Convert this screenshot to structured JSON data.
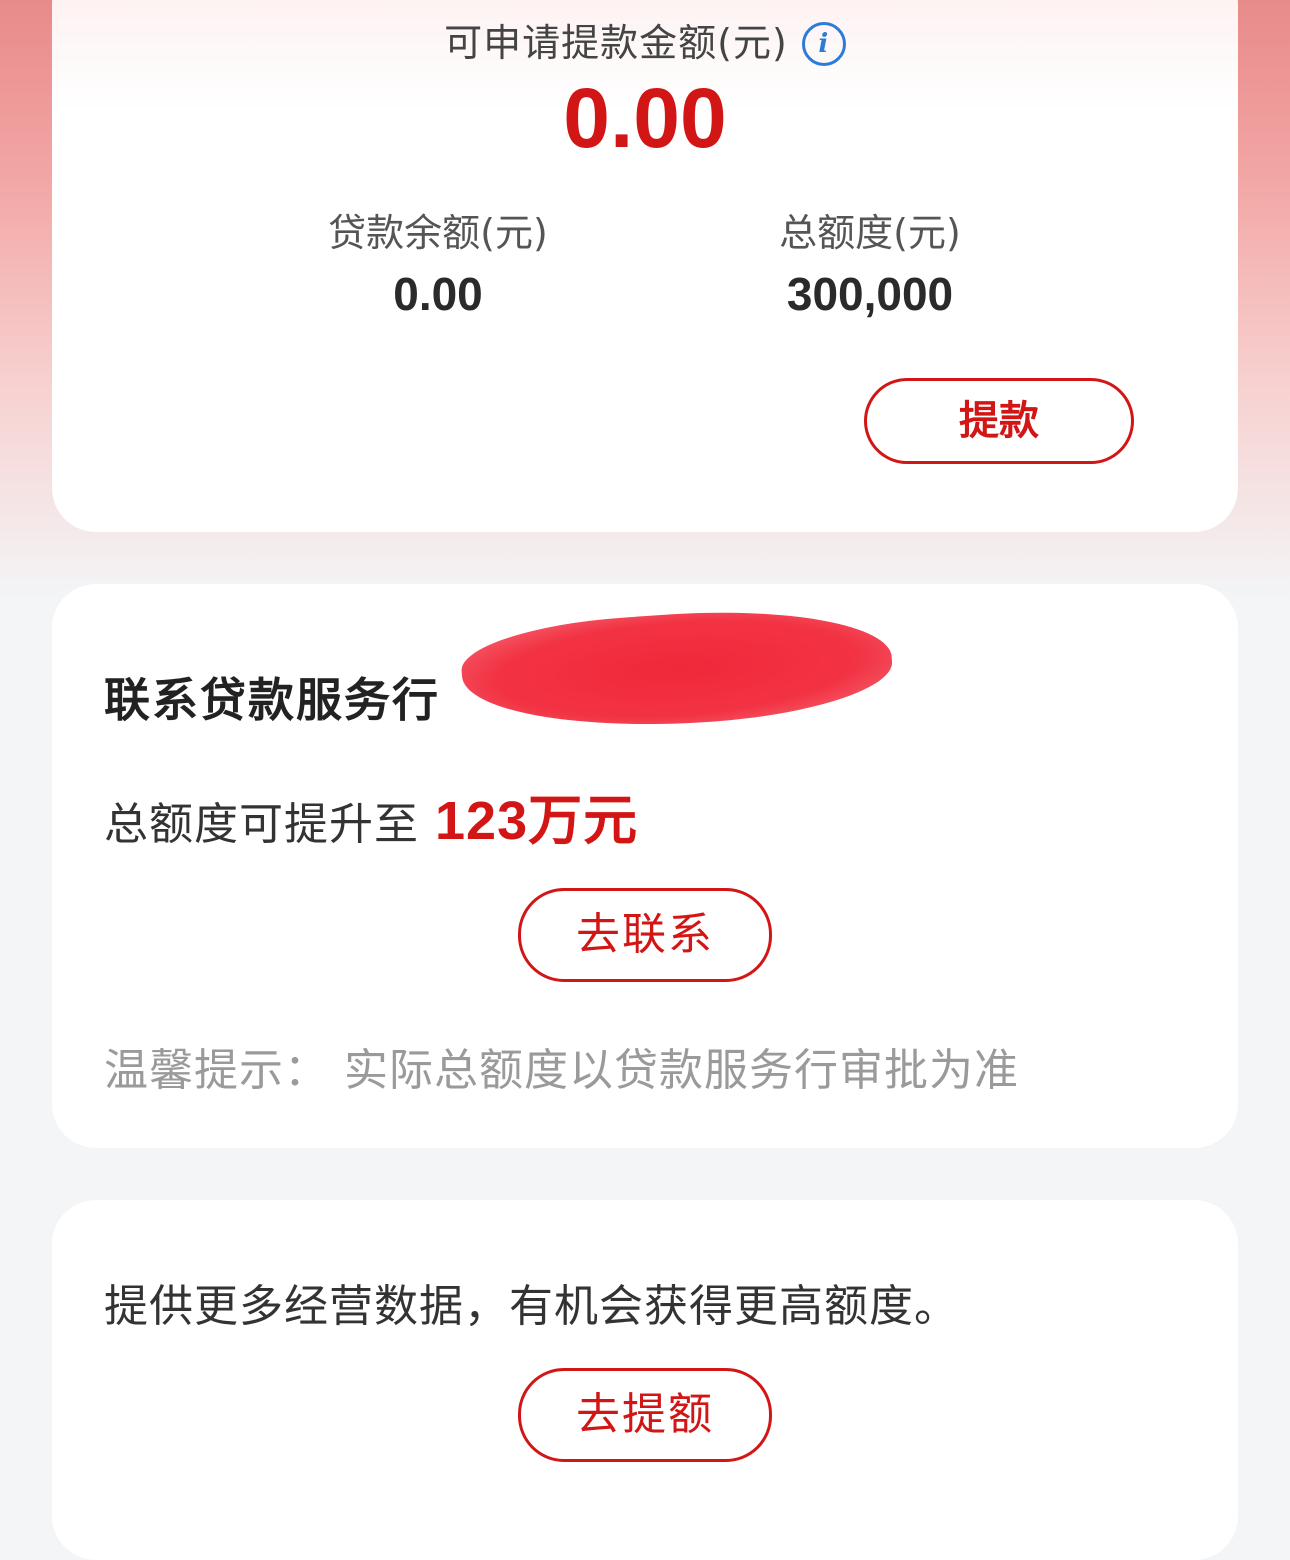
{
  "credit_summary": {
    "available_label": "可申请提款金额(元)",
    "available_amount": "0.00",
    "loan_balance_label": "贷款余额(元)",
    "loan_balance_value": "0.00",
    "total_limit_label": "总额度(元)",
    "total_limit_value": "300,000",
    "withdraw_button": "提款",
    "info_icon": "info-icon"
  },
  "contact_card": {
    "title": "联系贷款服务行",
    "upgrade_text": "总额度可提升至",
    "upgrade_amount": "123万元",
    "contact_button": "去联系",
    "tip": "温馨提示：  实际总额度以贷款服务行审批为准"
  },
  "raise_card": {
    "text": "提供更多经营数据，有机会获得更高额度。",
    "raise_button": "去提额"
  },
  "colors": {
    "accent": "#d21515",
    "info_blue": "#2b7bd8",
    "redaction": "#f23344"
  }
}
